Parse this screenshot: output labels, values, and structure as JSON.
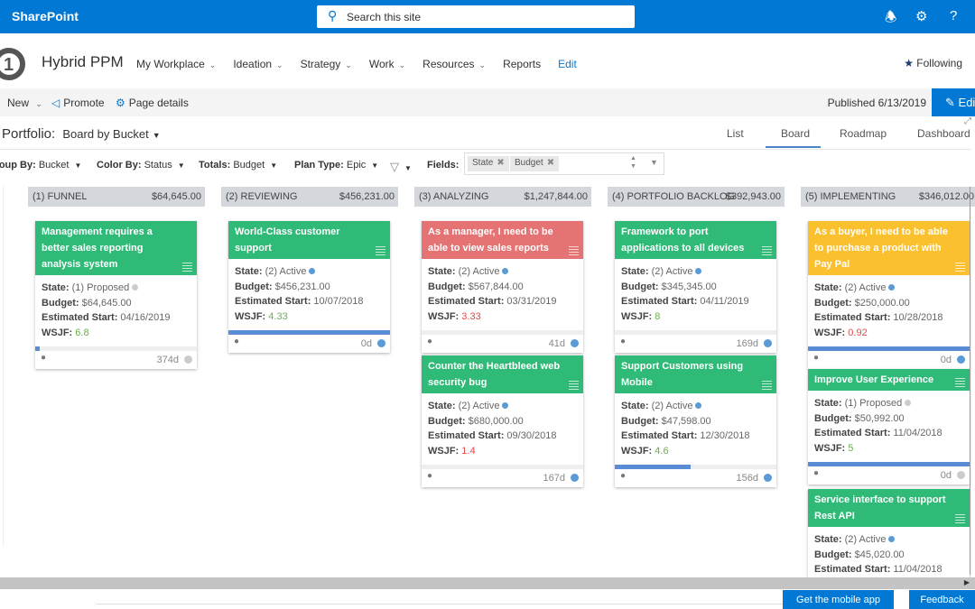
{
  "suitebar": {
    "brand": "SharePoint",
    "search_placeholder": "Search this site",
    "icons": [
      "bell-icon",
      "gear-icon",
      "help-icon"
    ]
  },
  "site": {
    "title": "Hybrid PPM",
    "nav": [
      {
        "label": "My Workplace",
        "chevron": true
      },
      {
        "label": "Ideation",
        "chevron": true
      },
      {
        "label": "Strategy",
        "chevron": true
      },
      {
        "label": "Work",
        "chevron": true
      },
      {
        "label": "Resources",
        "chevron": true
      },
      {
        "label": "Reports",
        "chevron": false
      },
      {
        "label": "Edit",
        "chevron": false
      }
    ],
    "following": "Following"
  },
  "commandbar": {
    "new": "New",
    "promote": "Promote",
    "page_details": "Page details",
    "published": "Published 6/13/2019",
    "edit": "Edit"
  },
  "portfolio": {
    "label": "Portfolio:",
    "view": "Board by Bucket",
    "tabs": [
      "List",
      "Board",
      "Roadmap",
      "Dashboard"
    ],
    "active_tab": "Board"
  },
  "filters": {
    "group_by": {
      "label": "Group By:",
      "value": "Bucket"
    },
    "color_by": {
      "label": "Color By:",
      "value": "Status"
    },
    "totals": {
      "label": "Totals:",
      "value": "Budget"
    },
    "plan_type": {
      "label": "Plan Type:",
      "value": "Epic"
    },
    "fields_label": "Fields:",
    "fields": [
      "State",
      "Budget"
    ]
  },
  "colors": {
    "green": "#2fba78",
    "red": "#e57373",
    "yellow": "#fbc02d",
    "active": "#5b9bd5",
    "proposed": "#cccccc",
    "wsjf_green": "#6ab04c",
    "wsjf_red": "#e04b4b"
  },
  "labels": {
    "state": "State:",
    "budget": "Budget:",
    "start": "Estimated Start:",
    "wsjf": "WSJF:"
  },
  "columns": [
    {
      "name": "(1) FUNNEL",
      "total": "$64,645.00",
      "cards": [
        {
          "title": "Management requires a better sales reporting analysis system",
          "color": "green",
          "state": "(1) Proposed",
          "state_kind": "proposed",
          "budget": "$64,645.00",
          "start": "04/16/2019",
          "wsjf": "6.8",
          "wsjf_kind": "green",
          "progress": 0.02,
          "days": "374d",
          "status_kind": "proposed"
        }
      ]
    },
    {
      "name": "(2) REVIEWING",
      "total": "$456,231.00",
      "cards": [
        {
          "title": "World-Class customer support",
          "color": "green",
          "state": "(2) Active",
          "state_kind": "active",
          "budget": "$456,231.00",
          "start": "10/07/2018",
          "wsjf": "4.33",
          "wsjf_kind": "green",
          "progress": 1.0,
          "days": "0d",
          "status_kind": "active"
        }
      ]
    },
    {
      "name": "(3) ANALYZING",
      "total": "$1,247,844.00",
      "cards": [
        {
          "title": "As a manager, I need to be able to view sales reports",
          "color": "red",
          "state": "(2) Active",
          "state_kind": "active",
          "budget": "$567,844.00",
          "start": "03/31/2019",
          "wsjf": "3.33",
          "wsjf_kind": "red",
          "progress": 0,
          "days": "41d",
          "status_kind": "active"
        },
        {
          "title": "Counter the Heartbleed web security bug",
          "color": "green",
          "state": "(2) Active",
          "state_kind": "active",
          "budget": "$680,000.00",
          "start": "09/30/2018",
          "wsjf": "1.4",
          "wsjf_kind": "red",
          "progress": 0,
          "days": "167d",
          "status_kind": "active"
        }
      ]
    },
    {
      "name": "(4) PORTFOLIO BACKLOG",
      "total": "$392,943.00",
      "cards": [
        {
          "title": "Framework to port applications to all devices",
          "color": "green",
          "state": "(2) Active",
          "state_kind": "active",
          "budget": "$345,345.00",
          "start": "04/11/2019",
          "wsjf": "8",
          "wsjf_kind": "green",
          "progress": 0,
          "days": "169d",
          "status_kind": "active"
        },
        {
          "title": "Support Customers using Mobile",
          "color": "green",
          "state": "(2) Active",
          "state_kind": "active",
          "budget": "$47,598.00",
          "start": "12/30/2018",
          "wsjf": "4.6",
          "wsjf_kind": "green",
          "progress": 0.47,
          "days": "156d",
          "status_kind": "active"
        }
      ]
    },
    {
      "name": "(5) IMPLEMENTING",
      "total": "$346,012.00",
      "cards": [
        {
          "title": "As a buyer, I need to be able to purchase a product with Pay Pal",
          "color": "yellow",
          "state": "(2) Active",
          "state_kind": "active",
          "budget": "$250,000.00",
          "start": "10/28/2018",
          "wsjf": "0.92",
          "wsjf_kind": "red",
          "progress": 1.0,
          "days": "0d",
          "status_kind": "active"
        },
        {
          "title": "Improve User Experience",
          "color": "green",
          "state": "(1) Proposed",
          "state_kind": "proposed",
          "budget": "$50,992.00",
          "start": "11/04/2018",
          "wsjf": "5",
          "wsjf_kind": "green",
          "progress": 1.0,
          "days": "0d",
          "status_kind": "proposed"
        },
        {
          "title": "Service interface to support Rest API",
          "color": "green",
          "state": "(2) Active",
          "state_kind": "active",
          "budget": "$45,020.00",
          "start": "11/04/2018",
          "wsjf": null,
          "wsjf_kind": null,
          "progress": null,
          "days": null,
          "status_kind": "active"
        }
      ]
    }
  ],
  "footer": {
    "mobile_app": "Get the mobile app",
    "feedback": "Feedback"
  }
}
